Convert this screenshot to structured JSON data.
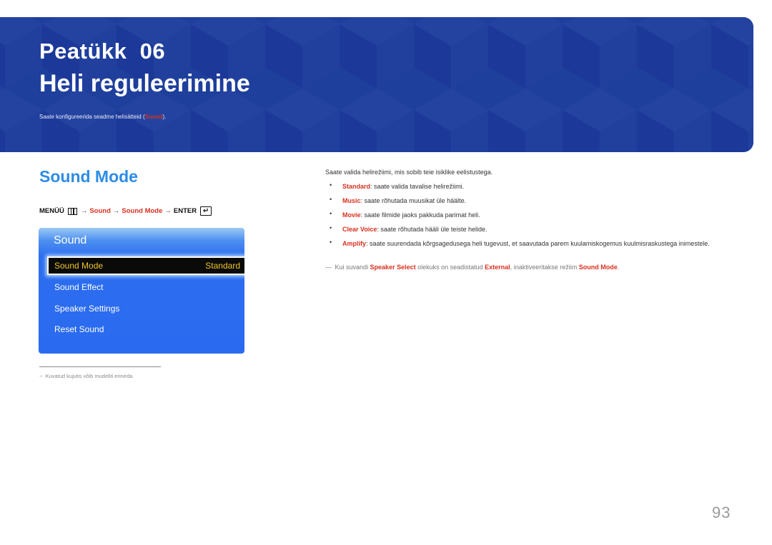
{
  "banner": {
    "chapter_label": "Peatükk  06",
    "title": "Heli reguleerimine",
    "description_prefix": "Saate konfigureerida seadme helisätteid (",
    "description_highlight": "Sound",
    "description_suffix": ").",
    "background_color": "#1f3f9c"
  },
  "section": {
    "title": "Sound Mode"
  },
  "menu_path": {
    "menu_label": "MENÜÜ",
    "menu_icon": "menu-icon",
    "arrow": "→",
    "step1": "Sound",
    "step2": "Sound Mode",
    "enter_label": "ENTER",
    "enter_icon": "enter-icon",
    "enter_glyph": "↵"
  },
  "osd_panel": {
    "title": "Sound",
    "items": [
      {
        "label": "Sound Mode",
        "value": "Standard",
        "selected": true
      },
      {
        "label": "Sound Effect"
      },
      {
        "label": "Speaker Settings"
      },
      {
        "label": "Reset Sound"
      }
    ]
  },
  "footnote": {
    "dash": "−",
    "text": "Kuvatud kujutis võib mudeliti erineda."
  },
  "content": {
    "intro": "Saate valida helirežiimi, mis sobib teie isiklike eelistustega.",
    "bullet_glyph": "•",
    "options": [
      {
        "term": "Standard",
        "desc": ": saate valida tavalise helirežiimi."
      },
      {
        "term": "Music",
        "desc": ": saate rõhutada muusikat üle häälte."
      },
      {
        "term": "Movie",
        "desc": ": saate filmide jaoks pakkuda parimat heli."
      },
      {
        "term": "Clear Voice",
        "desc": ": saate rõhutada hääli üle teiste helide."
      },
      {
        "term": "Amplify",
        "desc": ": saate suurendada kõrgsagedusega heli tugevust, et saavutada parem kuulamiskogemus kuulmisraskustega inimestele."
      }
    ],
    "note": {
      "dash": "—",
      "part1": "Kui suvandi ",
      "term1": "Speaker Select",
      "part2": " olekuks on seadistatud ",
      "term2": "External",
      "part3": ", inaktiveeritakse režiim ",
      "term3": "Sound Mode",
      "part4": "."
    }
  },
  "page_number": "93",
  "colors": {
    "accent_red": "#d8301e",
    "section_blue": "#2d8ce6",
    "osd_blue": "#2a6af0",
    "osd_selected_text": "#f0c530"
  }
}
